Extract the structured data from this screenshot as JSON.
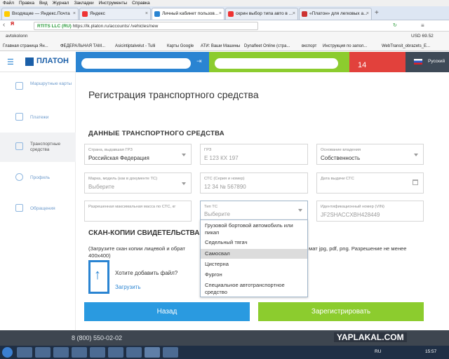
{
  "browser": {
    "menu": [
      "Файл",
      "Правка",
      "Вид",
      "Журнал",
      "Закладки",
      "Инструменты",
      "Справка"
    ],
    "tabs": [
      {
        "label": "Входящие — Яндекс.Почта",
        "color": "#ffcc00"
      },
      {
        "label": "Яндекс",
        "color": "#e33"
      },
      {
        "label": "Личный кабинет пользов...",
        "color": "#2a84d2"
      },
      {
        "label": "скрин выбор типа авто в ...",
        "color": "#e33"
      },
      {
        "label": "«Платон» для легковых а...",
        "color": "#c33"
      }
    ],
    "address": "https://lk.platon.ru/accounts/        /vehicles/new",
    "site_badge": "RTITS LLC (RU)",
    "bookmarks": [
      "Главная страница Ян...",
      "ФЕДЕРАЛЬНАЯ ТАМ...",
      "Asicintiptalvelut - Tulli",
      "Карты Google",
      "АТИ: Ваши Машины",
      "Dynafleet Online (стра...",
      "вкспорт",
      "Инструкция по запол...",
      "WebTransit_obrazets_E..."
    ],
    "usd": "USD 69.52"
  },
  "header": {
    "logo": "ПЛАТОН",
    "notification_count": "14",
    "language": "Русский"
  },
  "sidebar": {
    "items": [
      {
        "label": "Маршрутные карты",
        "icon": "route-card-icon"
      },
      {
        "label": "Платежи",
        "icon": "payment-icon"
      },
      {
        "label": "Транспортные средства",
        "icon": "vehicle-icon"
      },
      {
        "label": "Профиль",
        "icon": "profile-icon"
      },
      {
        "label": "Обращения",
        "icon": "message-icon"
      }
    ]
  },
  "page": {
    "title": "Регистрация транспортного средства",
    "section_vehicle": "ДАННЫЕ ТРАНСПОРТНОГО СРЕДСТВА",
    "fields": {
      "country": {
        "label": "Страна, выдавшая ГРЗ",
        "value": "Российская Федерация"
      },
      "plate": {
        "label": "ГРЗ",
        "placeholder": "Е 123 КХ 197"
      },
      "ownership": {
        "label": "Основание владения",
        "value": "Собственность"
      },
      "brand": {
        "label": "Марка, модель (как в документе ТС)",
        "placeholder": "Выберите"
      },
      "sts": {
        "label": "СТС (Серия и номер)",
        "placeholder": "12 34 № 567890"
      },
      "sts_date": {
        "label": "Дата выдачи СТС"
      },
      "max_mass": {
        "label": "Разрешенная максимальная масса по СТС, кг"
      },
      "type": {
        "label": "Тип ТС",
        "placeholder": "Выберите"
      },
      "vin": {
        "label": "Идентификационный номер (VIN)",
        "placeholder": "JF2SHACCXBH428449"
      }
    },
    "type_options": [
      "Грузовой бортовой автомобиль или пикап",
      "Седельный тягач",
      "Самосвал",
      "Цистерна",
      "Фургон",
      "Специальное автотранспортное средство"
    ],
    "selected_option_index": 2,
    "section_scans": "СКАН-КОПИИ СВИДЕТЕЛЬСТВА",
    "scan_hint_left": "(Загрузите скан копии лицевой и обрат",
    "scan_hint_right": "мат jpg, pdf, png. Разрешение не менее",
    "scan_hint_line2": "400x400)",
    "upload_question": "Хотите добавить файл?",
    "upload_link": "Загрузить",
    "back_button": "Назад",
    "register_button": "Зарегистрировать"
  },
  "footer": {
    "phone": "8 (800) 550-02-02",
    "watermark": "YAPLAKAL.COM"
  },
  "taskbar": {
    "lang": "RU",
    "time": "15:57"
  },
  "colors": {
    "blue": "#2a84d2",
    "green": "#8ccc2e",
    "red": "#e2413c"
  }
}
